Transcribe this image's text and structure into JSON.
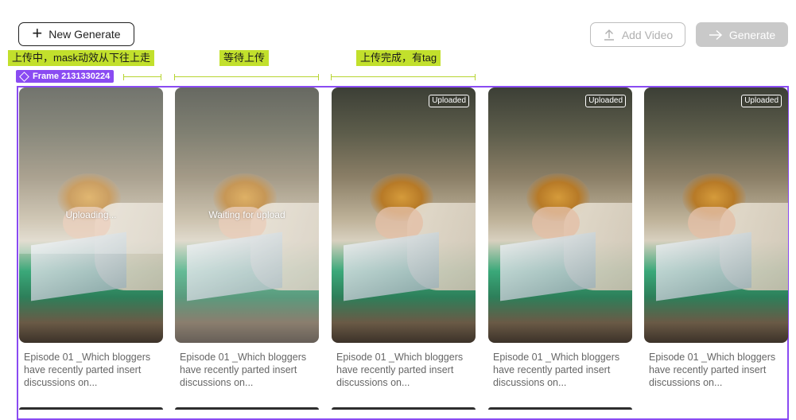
{
  "toolbar": {
    "new_generate_label": "New Generate",
    "add_video_label": "Add Video",
    "generate_label": "Generate"
  },
  "annotations": {
    "uploading_note": "上传中，mask动效从下往上走",
    "waiting_note": "等待上传",
    "uploaded_note": "上传完成，有tag"
  },
  "frame": {
    "label": "Frame 2131330224"
  },
  "cards": [
    {
      "status_text": "Uploading...",
      "tag": "",
      "caption": "Episode 01 _Which bloggers have recently parted insert discussions on..."
    },
    {
      "status_text": "Waiting for upload",
      "tag": "",
      "caption": "Episode 01 _Which bloggers have recently parted insert discussions on..."
    },
    {
      "status_text": "",
      "tag": "Uploaded",
      "caption": "Episode 01 _Which bloggers have recently parted insert discussions on..."
    },
    {
      "status_text": "",
      "tag": "Uploaded",
      "caption": "Episode 01 _Which bloggers have recently parted insert discussions on..."
    },
    {
      "status_text": "",
      "tag": "Uploaded",
      "caption": "Episode 01 _Which bloggers have recently parted insert discussions on..."
    }
  ],
  "colors": {
    "accent": "#8a4bf2",
    "annotation": "#c2e02c",
    "disabled": "#c9c9c9"
  },
  "icons": {
    "new": "plus-icon",
    "add_video": "upload-icon",
    "generate": "arrow-right-icon",
    "frame": "diamond-icon"
  }
}
